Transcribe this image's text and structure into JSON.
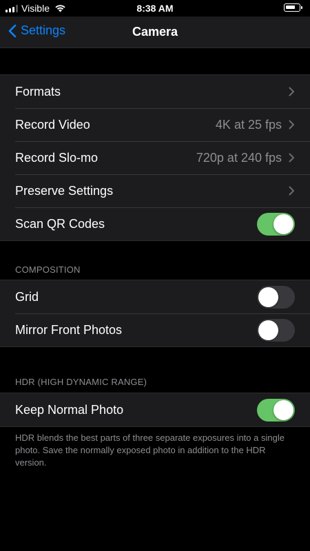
{
  "status_bar": {
    "carrier": "Visible",
    "time": "8:38 AM"
  },
  "nav": {
    "back_label": "Settings",
    "title": "Camera"
  },
  "main_group": [
    {
      "label": "Formats",
      "value": "",
      "control": "chevron"
    },
    {
      "label": "Record Video",
      "value": "4K at 25 fps",
      "control": "chevron"
    },
    {
      "label": "Record Slo-mo",
      "value": "720p at 240 fps",
      "control": "chevron"
    },
    {
      "label": "Preserve Settings",
      "value": "",
      "control": "chevron"
    },
    {
      "label": "Scan QR Codes",
      "control": "toggle",
      "on": true
    }
  ],
  "composition": {
    "header": "COMPOSITION",
    "items": [
      {
        "label": "Grid",
        "control": "toggle",
        "on": false
      },
      {
        "label": "Mirror Front Photos",
        "control": "toggle",
        "on": false
      }
    ]
  },
  "hdr": {
    "header": "HDR (HIGH DYNAMIC RANGE)",
    "items": [
      {
        "label": "Keep Normal Photo",
        "control": "toggle",
        "on": true
      }
    ],
    "footer": "HDR blends the best parts of three separate exposures into a single photo. Save the normally exposed photo in addition to the HDR version."
  },
  "colors": {
    "accent": "#0a84ff",
    "toggle_on": "#65c466",
    "toggle_off": "#39393d",
    "row_background": "#1c1c1e",
    "secondary_text": "#8e8e93"
  },
  "icons": {
    "back": "chevron-left-icon",
    "disclosure": "chevron-right-icon",
    "wifi": "wifi-icon",
    "signal": "cellular-signal-icon",
    "battery": "battery-icon"
  }
}
